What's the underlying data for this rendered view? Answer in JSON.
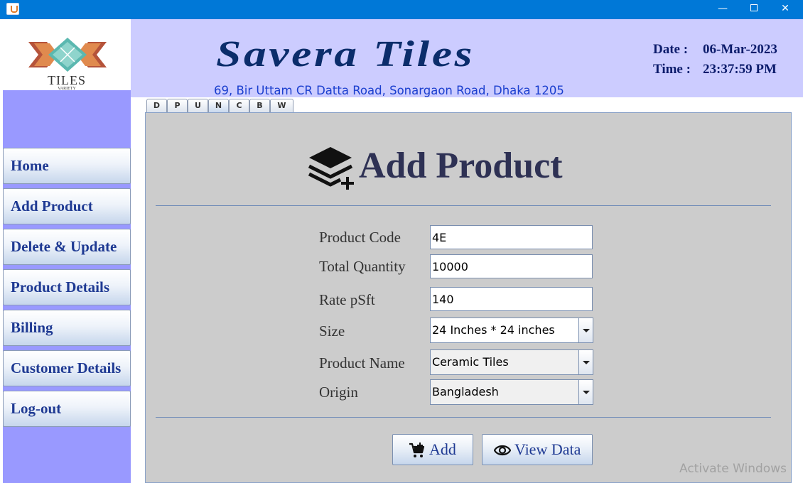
{
  "window": {
    "minimize_glyph": "—",
    "close_glyph": "✕"
  },
  "logo": {
    "text": "TILES",
    "subtext": "VARIETY"
  },
  "header": {
    "brand": "Savera Tiles",
    "address": "69, Bir Uttam CR Datta Road, Sonargaon Road, Dhaka 1205",
    "date_label": "Date :",
    "date_value": "06-Mar-2023",
    "time_label": "Time :",
    "time_value": "23:37:59 PM"
  },
  "sidebar": {
    "items": [
      {
        "label": "Home"
      },
      {
        "label": "Add Product"
      },
      {
        "label": "Delete & Update"
      },
      {
        "label": "Product Details"
      },
      {
        "label": "Billing"
      },
      {
        "label": "Customer Details"
      },
      {
        "label": "Log-out"
      }
    ]
  },
  "tabs": [
    {
      "label": "D"
    },
    {
      "label": "P"
    },
    {
      "label": "U"
    },
    {
      "label": "N",
      "active": true
    },
    {
      "label": "C"
    },
    {
      "label": "B"
    },
    {
      "label": "W"
    }
  ],
  "form": {
    "title": "Add Product",
    "product_code": {
      "label": "Product Code",
      "value": "4E"
    },
    "total_quantity": {
      "label": "Total Quantity",
      "value": "10000"
    },
    "rate": {
      "label": "Rate pSft",
      "value": "140"
    },
    "size": {
      "label": "Size",
      "value": "24 Inches * 24 inches"
    },
    "product_name": {
      "label": "Product Name",
      "value": "Ceramic Tiles"
    },
    "origin": {
      "label": "Origin",
      "value": "Bangladesh"
    },
    "add_button": "Add",
    "view_button": "View Data"
  },
  "watermark": "Activate Windows",
  "colors": {
    "titlebar": "#0078d7",
    "sidebar": "#9999ff",
    "header": "#ccccff",
    "brand": "#0b2d6b",
    "nav_text": "#1f3a93",
    "panel": "#cccccc"
  },
  "icons": {
    "title_icon": "layers-plus-icon",
    "add_icon": "cart-plus-icon",
    "view_icon": "eye-icon"
  }
}
